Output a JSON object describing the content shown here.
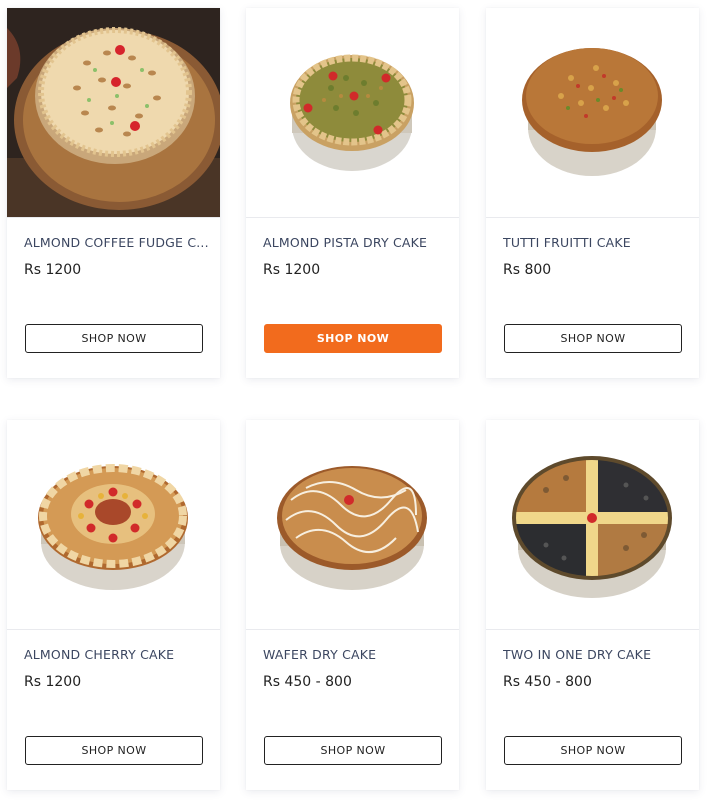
{
  "products": [
    {
      "title": "ALMOND COFFEE FUDGE C...",
      "price": "Rs 1200",
      "button": "SHOP NOW",
      "image": "almond-coffee-fudge-cake-photo"
    },
    {
      "title": "ALMOND PISTA DRY CAKE",
      "price": "Rs 1200",
      "button": "SHOP NOW",
      "image": "almond-pista-dry-cake-photo",
      "highlighted": true
    },
    {
      "title": "TUTTI FRUITTI CAKE",
      "price": "Rs 800",
      "button": "SHOP NOW",
      "image": "tutti-fruitti-cake-photo"
    },
    {
      "title": "ALMOND CHERRY CAKE",
      "price": "Rs 1200",
      "button": "SHOP NOW",
      "image": "almond-cherry-cake-photo"
    },
    {
      "title": "WAFER DRY CAKE",
      "price": "Rs 450 - 800",
      "button": "SHOP NOW",
      "image": "wafer-dry-cake-photo"
    },
    {
      "title": "TWO IN ONE DRY CAKE",
      "price": "Rs 450 - 800",
      "button": "SHOP NOW",
      "image": "two-in-one-dry-cake-photo"
    }
  ],
  "colors": {
    "accent": "#f26b1d",
    "title_text": "#3b4660",
    "card_bg": "#ffffff"
  }
}
